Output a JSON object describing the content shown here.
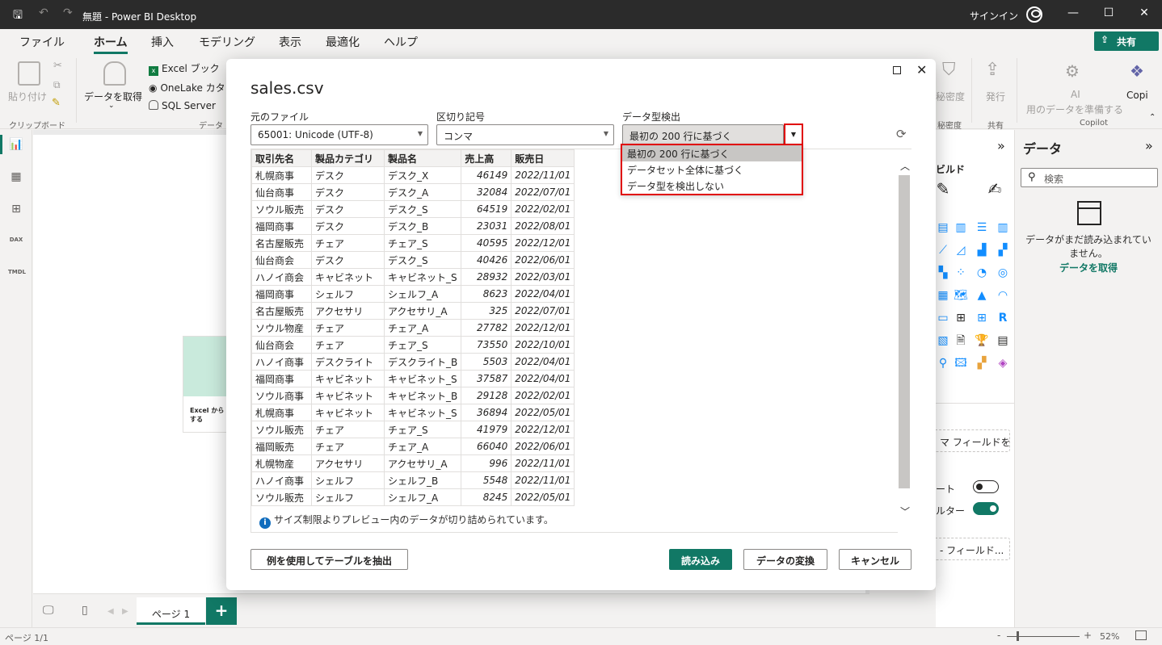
{
  "window": {
    "title": "無題 - Power BI Desktop",
    "signin": "サインイン"
  },
  "ribbon_tabs": [
    "ファイル",
    "ホーム",
    "挿入",
    "モデリング",
    "表示",
    "最適化",
    "ヘルプ"
  ],
  "share_label": "共有",
  "ribbon": {
    "paste": "貼り付け",
    "clipboard_group": "クリップボード",
    "get_data": "データを取得",
    "excel_book": "Excel ブック",
    "onelake": "OneLake カタロ",
    "sql_server": "SQL Server",
    "data_group": "データ",
    "sensitivity": "秘密度",
    "sensitivity_group": "秘密度",
    "publish": "発行",
    "share_group": "共有",
    "ai_label": "AI",
    "ai_prepare": "用のデータを準備する",
    "copilot": "Copi",
    "copilot_group": "Copilot"
  },
  "canvas_card_text": "Excel から\nする",
  "page_tab": "ページ 1",
  "status": {
    "page": "ページ 1/1",
    "zoom": "52%"
  },
  "viz_pane": {
    "build": "ビルド",
    "field_box_1": "マ フィールドを...",
    "toggle_1_label": "ート",
    "toggle_2_label": "ルター",
    "field_box_2": "- フィールド..."
  },
  "data_pane": {
    "title": "データ",
    "search_placeholder": "検索",
    "message": "データがまだ読み込まれていません。",
    "get_data_link": "データを取得"
  },
  "dialog": {
    "title": "sales.csv",
    "file_origin_label": "元のファイル",
    "file_origin_value": "65001: Unicode (UTF-8)",
    "delimiter_label": "区切り記号",
    "delimiter_value": "コンマ",
    "type_detect_label": "データ型検出",
    "type_detect_value": "最初の 200 行に基づく",
    "type_detect_options": [
      "最初の 200 行に基づく",
      "データセット全体に基づく",
      "データ型を検出しない"
    ],
    "columns": [
      "取引先名",
      "製品カテゴリ",
      "製品名",
      "売上高",
      "販売日"
    ],
    "rows": [
      [
        "札幌商事",
        "デスク",
        "デスク_X",
        "46149",
        "2022/11/01"
      ],
      [
        "仙台商事",
        "デスク",
        "デスク_A",
        "32084",
        "2022/07/01"
      ],
      [
        "ソウル販売",
        "デスク",
        "デスク_S",
        "64519",
        "2022/02/01"
      ],
      [
        "福岡商事",
        "デスク",
        "デスク_B",
        "23031",
        "2022/08/01"
      ],
      [
        "名古屋販売",
        "チェア",
        "チェア_S",
        "40595",
        "2022/12/01"
      ],
      [
        "仙台商会",
        "デスク",
        "デスク_S",
        "40426",
        "2022/06/01"
      ],
      [
        "ハノイ商会",
        "キャビネット",
        "キャビネット_S",
        "28932",
        "2022/03/01"
      ],
      [
        "福岡商事",
        "シェルフ",
        "シェルフ_A",
        "8623",
        "2022/04/01"
      ],
      [
        "名古屋販売",
        "アクセサリ",
        "アクセサリ_A",
        "325",
        "2022/07/01"
      ],
      [
        "ソウル物産",
        "チェア",
        "チェア_A",
        "27782",
        "2022/12/01"
      ],
      [
        "仙台商会",
        "チェア",
        "チェア_S",
        "73550",
        "2022/10/01"
      ],
      [
        "ハノイ商事",
        "デスクライト",
        "デスクライト_B",
        "5503",
        "2022/04/01"
      ],
      [
        "福岡商事",
        "キャビネット",
        "キャビネット_S",
        "37587",
        "2022/04/01"
      ],
      [
        "ソウル商事",
        "キャビネット",
        "キャビネット_B",
        "29128",
        "2022/02/01"
      ],
      [
        "札幌商事",
        "キャビネット",
        "キャビネット_S",
        "36894",
        "2022/05/01"
      ],
      [
        "ソウル販売",
        "チェア",
        "チェア_S",
        "41979",
        "2022/12/01"
      ],
      [
        "福岡販売",
        "チェア",
        "チェア_A",
        "66040",
        "2022/06/01"
      ],
      [
        "札幌物産",
        "アクセサリ",
        "アクセサリ_A",
        "996",
        "2022/11/01"
      ],
      [
        "ハノイ商事",
        "シェルフ",
        "シェルフ_B",
        "5548",
        "2022/11/01"
      ],
      [
        "ソウル販売",
        "シェルフ",
        "シェルフ_A",
        "8245",
        "2022/05/01"
      ]
    ],
    "truncation_note": "サイズ制限よりプレビュー内のデータが切り詰められています。",
    "extract_button": "例を使用してテーブルを抽出",
    "load_button": "読み込み",
    "transform_button": "データの変換",
    "cancel_button": "キャンセル"
  },
  "colors": {
    "accent": "#117865",
    "highlight": "#e00000",
    "titlebar": "#2b2b2b"
  }
}
